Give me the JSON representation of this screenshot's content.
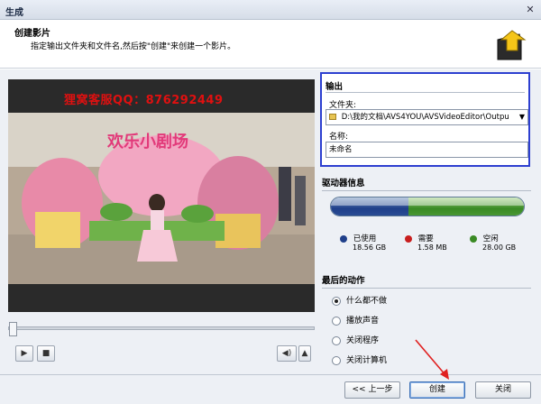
{
  "window": {
    "title": "生成",
    "close_glyph": "✕"
  },
  "header": {
    "title": "创建影片",
    "subtitle": "指定输出文件夹和文件名,然后按\"创建\"来创建一个影片。"
  },
  "video": {
    "watermark": "狸窝客服QQ：876292449",
    "scene_text": "欢乐小剧场"
  },
  "player": {
    "play_glyph": "▶",
    "stop_glyph": "■",
    "volume_glyph": "◀)",
    "volume_arrow": "▲"
  },
  "output": {
    "section_title": "输出",
    "folder_label": "文件夹:",
    "folder_value": "D:\\我的文档\\AVS4YOU\\AVSVideoEditor\\Outpu",
    "name_label": "名称:",
    "name_value": "未命名"
  },
  "drive": {
    "section_title": "驱动器信息",
    "used_label": "已使用",
    "used_value": "18.56 GB",
    "used_color": "#1f3f8a",
    "needed_label": "需要",
    "needed_value": "1.58 MB",
    "needed_color": "#c81e1e",
    "free_label": "空闲",
    "free_value": "28.00 GB",
    "free_color": "#3a8a24",
    "used_fraction": 0.3986
  },
  "last_action": {
    "section_title": "最后的动作",
    "options": [
      "什么都不做",
      "播放声音",
      "关闭程序",
      "关闭计算机"
    ],
    "selected_index": 0
  },
  "buttons": {
    "back": "<< 上一步",
    "create": "创建",
    "close": "关闭"
  }
}
